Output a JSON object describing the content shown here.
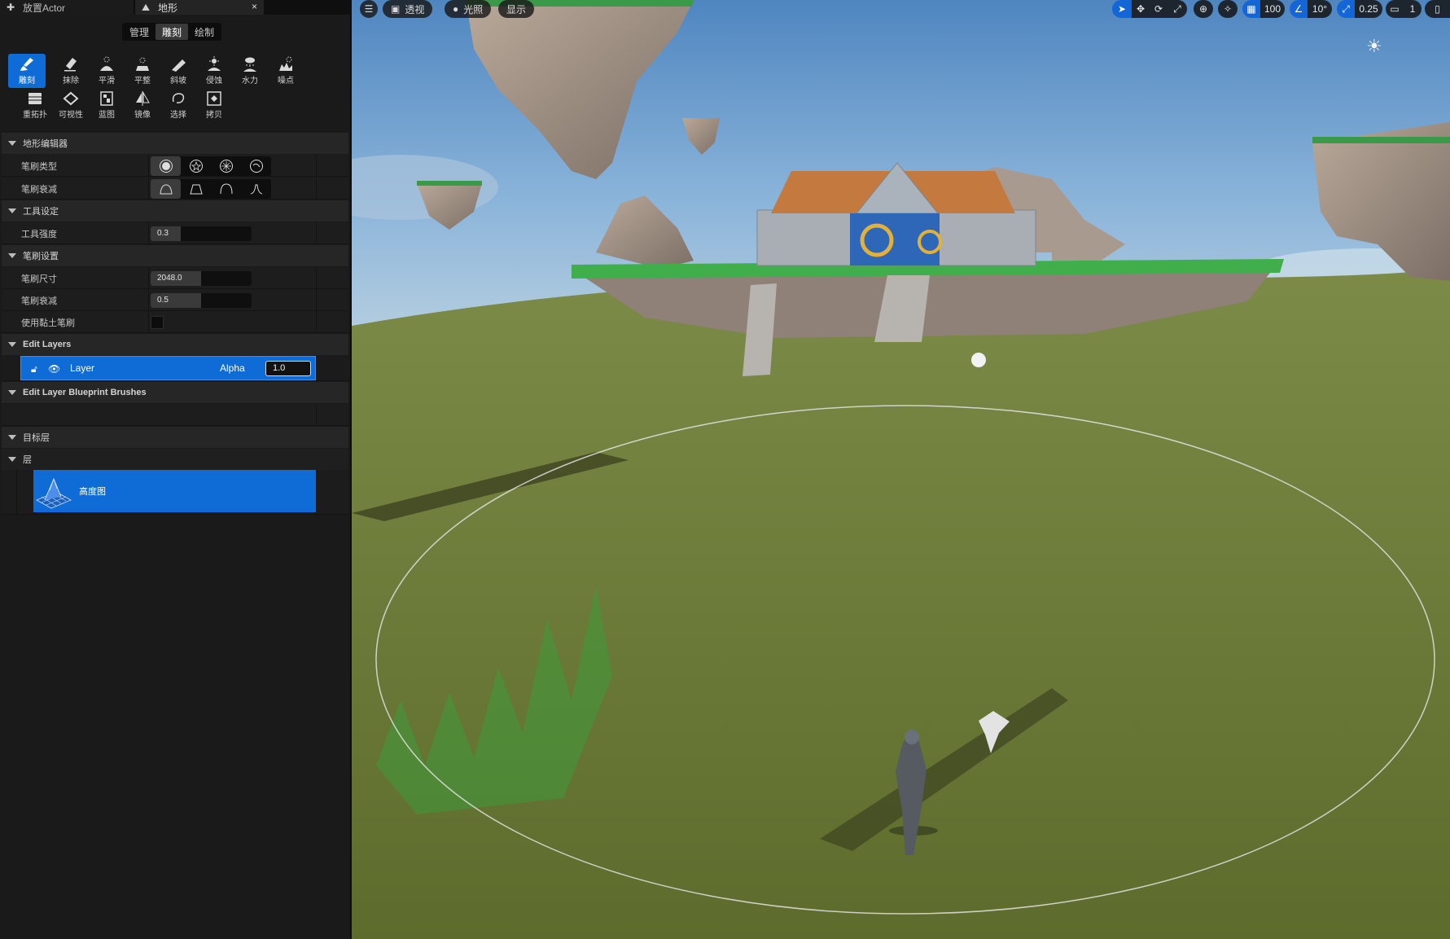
{
  "tabs": [
    {
      "label": "放置Actor",
      "icon": "place-actor-icon"
    },
    {
      "label": "地形",
      "icon": "landscape-mountain-icon"
    }
  ],
  "tab_close": "×",
  "modes": [
    "管理",
    "雕刻",
    "绘制"
  ],
  "active_mode": "雕刻",
  "tools": [
    {
      "label": "雕刻",
      "icon": "sculpt-brush-icon",
      "active": true
    },
    {
      "label": "抹除",
      "icon": "erase-icon"
    },
    {
      "label": "平滑",
      "icon": "smooth-icon"
    },
    {
      "label": "平整",
      "icon": "flatten-icon"
    },
    {
      "label": "斜坡",
      "icon": "ramp-icon"
    },
    {
      "label": "侵蚀",
      "icon": "erosion-icon"
    },
    {
      "label": "水力",
      "icon": "hydro-icon"
    },
    {
      "label": "噪点",
      "icon": "noise-icon"
    },
    {
      "label": "重拓扑",
      "icon": "retopologize-icon"
    },
    {
      "label": "可视性",
      "icon": "visibility-icon"
    },
    {
      "label": "蓝图",
      "icon": "blueprint-icon"
    },
    {
      "label": "镜像",
      "icon": "mirror-icon"
    },
    {
      "label": "选择",
      "icon": "select-icon"
    },
    {
      "label": "拷贝",
      "icon": "copy-icon"
    }
  ],
  "sections": {
    "terrain_editor": "地形编辑器",
    "tool_settings": "工具设定",
    "brush_settings": "笔刷设置",
    "edit_layers": "Edit Layers",
    "edit_layer_bp": "Edit Layer Blueprint Brushes",
    "target_layer": "目标层",
    "layers": "层"
  },
  "properties": {
    "brush_type": "笔刷类型",
    "brush_falloff_shape": "笔刷衰减",
    "tool_strength": {
      "label": "工具强度",
      "value": "0.3",
      "fraction": 0.3
    },
    "brush_size": {
      "label": "笔刷尺寸",
      "value": "2048.0",
      "fraction": 0.5
    },
    "brush_falloff": {
      "label": "笔刷衰减",
      "value": "0.5",
      "fraction": 0.5
    },
    "clay_brush": {
      "label": "使用黏土笔刷",
      "checked": false
    }
  },
  "edit_layer": {
    "name": "Layer",
    "alpha_label": "Alpha",
    "alpha_value": "1.0"
  },
  "target_layer": {
    "name": "高度图"
  },
  "viewport": {
    "left_buttons": [
      {
        "label": "",
        "icon": "hamburger-menu-icon"
      },
      {
        "label": "透视",
        "icon": "perspective-cube-icon"
      },
      {
        "label": "光照",
        "icon": "lit-sphere-icon"
      },
      {
        "label": "显示",
        "icon": ""
      }
    ],
    "grid_snap": "100",
    "rotation_snap": "10°",
    "scale_snap": "0.25",
    "camera_speed": "1"
  },
  "colors": {
    "accent": "#0f6bd6",
    "panel": "#1a1a1a",
    "sky": "#6e9cc9",
    "grass": "#6a7a34"
  }
}
